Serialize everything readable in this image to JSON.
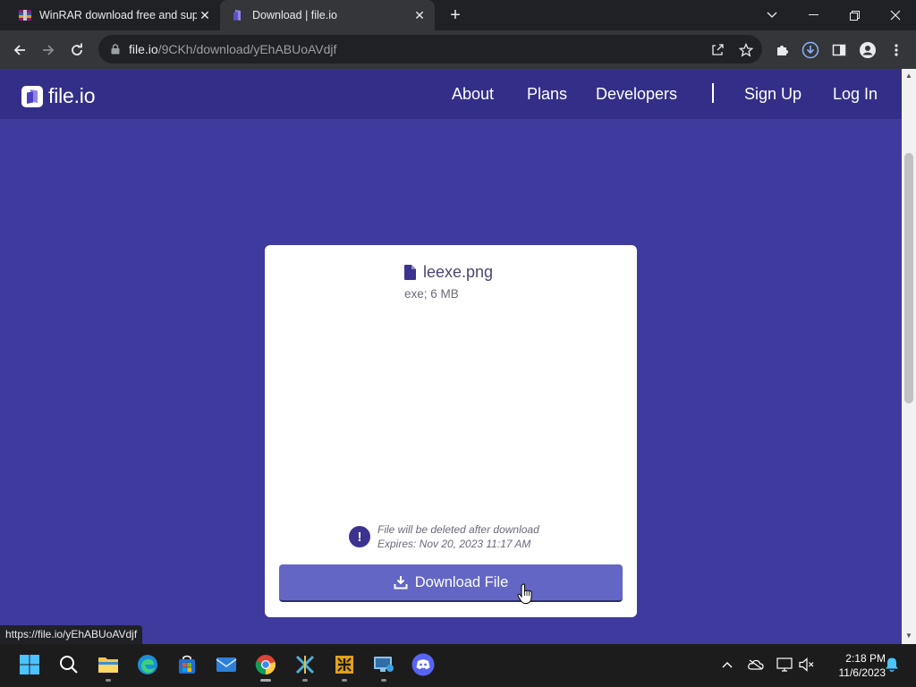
{
  "browser": {
    "tabs": [
      {
        "title": "WinRAR download free and support: WinRAR",
        "favicon": "winrar-icon"
      },
      {
        "title": "Download | file.io",
        "favicon": "fileio-icon"
      }
    ],
    "address": {
      "host": "file.io",
      "path": "/9CKh/download/yEhABUoAVdjf"
    },
    "status_url": "https://file.io/yEhABUoAVdjf"
  },
  "site": {
    "logo_text": "file.io",
    "nav": {
      "about": "About",
      "plans": "Plans",
      "developers": "Developers",
      "signup": "Sign Up",
      "login": "Log In"
    }
  },
  "file": {
    "name": "leexe.png",
    "meta": "exe; 6 MB",
    "notice_line1": "File will be deleted after download",
    "notice_line2": "Expires: Nov 20, 2023 11:17 AM",
    "download_label": "Download File"
  },
  "taskbar": {
    "apps": [
      "windows-start-icon",
      "search-icon",
      "file-explorer-icon",
      "edge-icon",
      "store-icon",
      "mail-icon",
      "chrome-icon",
      "app-x-icon",
      "app-arrows-icon",
      "remote-desktop-icon",
      "discord-icon"
    ],
    "time": "2:18 PM",
    "date": "11/6/2023"
  },
  "colors": {
    "page_bg": "#3f3a9e",
    "nav_bg": "#332f88",
    "button": "#6366c4"
  }
}
